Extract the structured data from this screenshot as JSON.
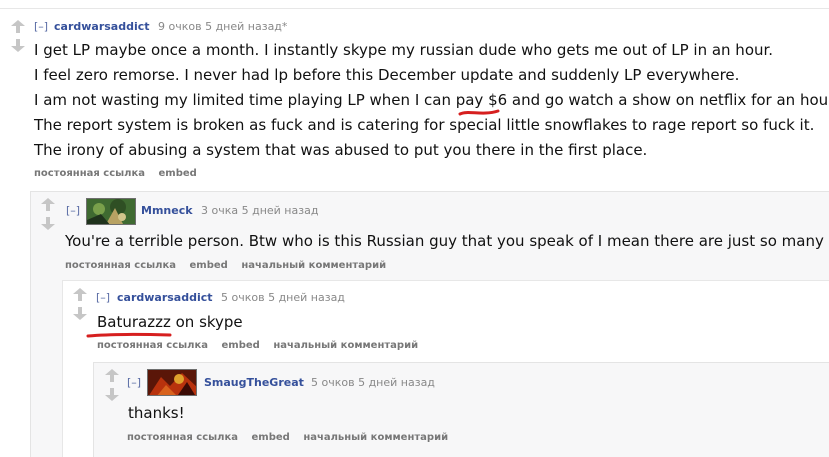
{
  "thread": {
    "icons": {
      "upvote": "upvote-icon",
      "downvote": "downvote-icon",
      "avatar": "avatar-image"
    },
    "colors": {
      "author": "#35509b",
      "meta": "#888888",
      "annotation": "#d61f1f"
    },
    "comments": [
      {
        "collapse": "[–]",
        "author": "cardwarsaddict",
        "score_time": "9 очков 5 дней назад*",
        "body": [
          "I get LP maybe once a month. I instantly skype my russian dude who gets me out of LP in an hour.",
          "I feel zero remorse. I never had lp before this December update and suddenly LP everywhere.",
          "I am not wasting my limited time playing LP when I can pay $6 and go watch a show on netflix for an hour.",
          "The report system is broken as fuck and is catering for special little snowflakes to rage report so fuck it.",
          "The irony of abusing a system that was abused to put you there in the first place."
        ],
        "links": [
          "постоянная ссылка",
          "embed"
        ]
      },
      {
        "collapse": "[–]",
        "author": "Mmneck",
        "score_time": "3 очка 5 дней назад",
        "body": [
          "You're a terrible person. Btw who is this Russian guy that you speak of I mean there are just so many"
        ],
        "links": [
          "постоянная ссылка",
          "embed",
          "начальный комментарий"
        ]
      },
      {
        "collapse": "[–]",
        "author": "cardwarsaddict",
        "score_time": "5 очков 5 дней назад",
        "body": [
          "Baturazzz on skype"
        ],
        "links": [
          "постоянная ссылка",
          "embed",
          "начальный комментарий"
        ]
      },
      {
        "collapse": "[–]",
        "author": "SmaugTheGreat",
        "score_time": "5 очков 5 дней назад",
        "body": [
          "thanks!"
        ],
        "links": [
          "постоянная ссылка",
          "embed",
          "начальный комментарий"
        ]
      }
    ]
  }
}
